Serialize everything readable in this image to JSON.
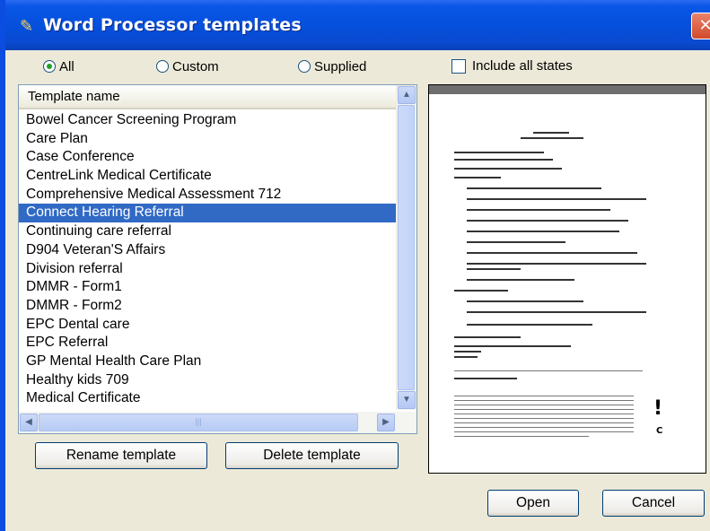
{
  "window": {
    "title": "Word Processor templates",
    "close_label": "✕"
  },
  "filter": {
    "options": [
      {
        "label": "All",
        "selected": true
      },
      {
        "label": "Custom",
        "selected": false
      },
      {
        "label": "Supplied",
        "selected": false
      }
    ],
    "include_all_states_label": "Include all states"
  },
  "list": {
    "column_header": "Template name",
    "items": [
      "Bowel Cancer Screening Program",
      "Care Plan",
      "Case Conference",
      "CentreLink Medical Certificate",
      "Comprehensive Medical Assessment 712",
      "Connect Hearing Referral",
      "Continuing care referral",
      "D904 Veteran'S Affairs",
      "Division referral",
      "DMMR - Form1",
      "DMMR - Form2",
      "EPC Dental care",
      "EPC Referral",
      "GP Mental Health Care Plan",
      "Healthy kids 709",
      "Medical Certificate"
    ],
    "selected_index": 5
  },
  "buttons": {
    "rename": "Rename template",
    "delete": "Delete template",
    "open": "Open",
    "cancel": "Cancel"
  },
  "colors": {
    "title_bar": "#0550dc",
    "selection": "#316ac5",
    "radio_dot": "#21a121"
  }
}
